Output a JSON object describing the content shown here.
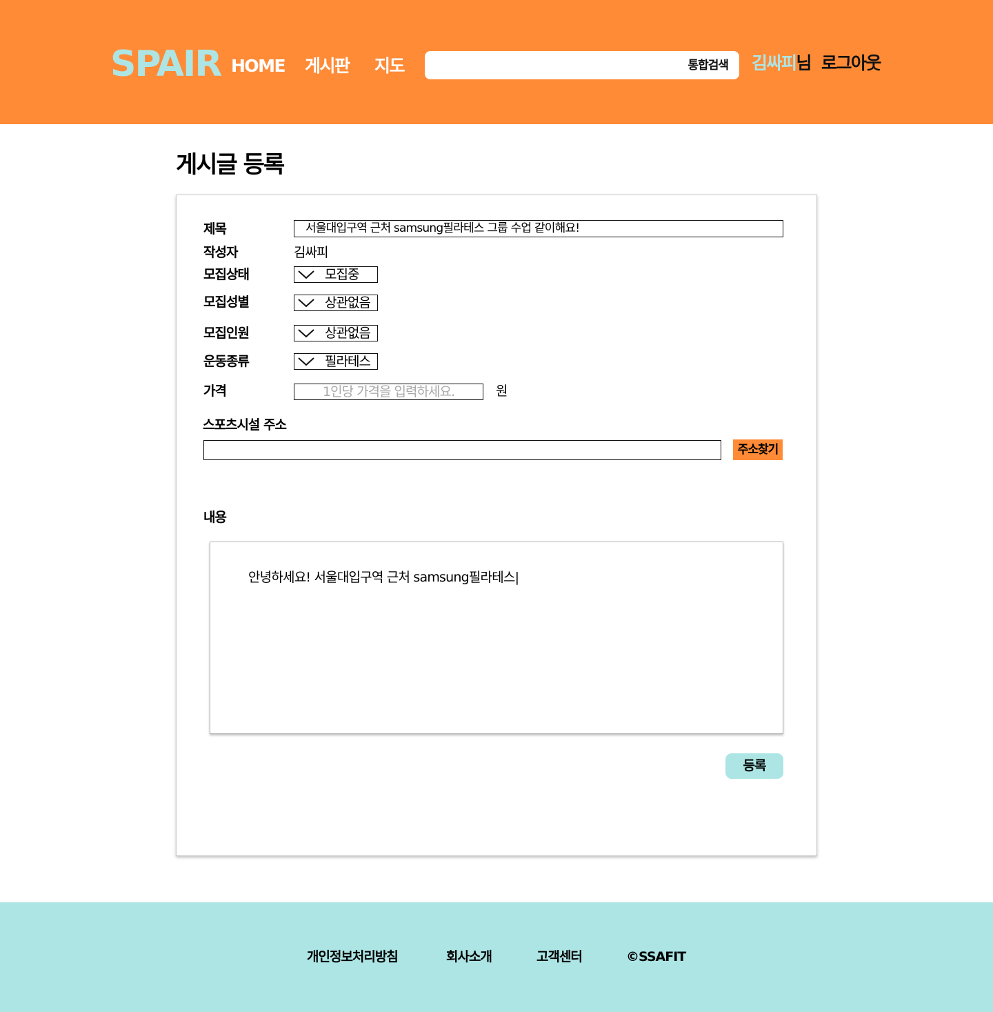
{
  "header": {
    "logo": "SPAIR",
    "nav": {
      "home": "HOME",
      "board": "게시판",
      "map": "지도"
    },
    "search": {
      "value": "",
      "placeholder": "",
      "button_label": "통합검색"
    },
    "user": {
      "name": "김싸피",
      "suffix": "님"
    },
    "logout_label": "로그아웃"
  },
  "page": {
    "title": "게시글 등록"
  },
  "form": {
    "title_label": "제목",
    "title_value": "서울대입구역 근처 samsung필라테스 그룹 수업 같이해요!",
    "author_label": "작성자",
    "author_value": "김싸피",
    "status_label": "모집상태",
    "status_value": "모집중",
    "gender_label": "모집성별",
    "gender_value": "상관없음",
    "headcount_label": "모집인원",
    "headcount_value": "상관없음",
    "sport_label": "운동종류",
    "sport_value": "필라테스",
    "price_label": "가격",
    "price_placeholder": "1인당 가격을 입력하세요.",
    "price_unit": "원",
    "address_label": "스포츠시설 주소",
    "address_value": "",
    "address_button": "주소찾기",
    "content_label": "내용",
    "content_value": "안녕하세요! 서울대입구역 근처 samsung필라테스|",
    "submit_label": "등록"
  },
  "footer": {
    "links": [
      "개인정보처리방침",
      "회사소개",
      "고객센터",
      "©SSAFIT"
    ]
  },
  "colors": {
    "primary_orange": "#FF8B37",
    "accent_mint": "#ADE5E5"
  },
  "icons": {
    "select_arrow": "chevron-down-icon"
  }
}
